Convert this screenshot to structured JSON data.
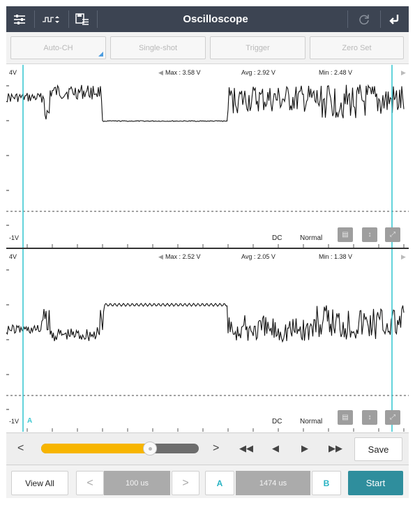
{
  "app": {
    "title": "Oscilloscope"
  },
  "toolbar": {
    "icons": [
      "sliders-icon",
      "waveform-select-icon",
      "save-list-icon",
      "refresh-icon",
      "back-icon"
    ]
  },
  "modes": {
    "auto_ch": "Auto-CH",
    "single_shot": "Single-shot",
    "trigger": "Trigger",
    "zero_set": "Zero Set"
  },
  "channels": [
    {
      "top_label": "4V",
      "bottom_label": "-1V",
      "max": "Max : 3.58 V",
      "avg": "Avg : 2.92 V",
      "min": "Min : 2.48 V",
      "coupling": "DC",
      "mode": "Normal"
    },
    {
      "top_label": "4V",
      "bottom_label": "-1V",
      "max": "Max : 2.52 V",
      "avg": "Avg : 2.05 V",
      "min": "Min : 1.38 V",
      "coupling": "DC",
      "mode": "Normal"
    }
  ],
  "cursors": {
    "a_label": "A",
    "b_label": "B"
  },
  "playback": {
    "prev": "<",
    "next": ">",
    "slider_fraction": 0.69,
    "rewind": "◀◀",
    "step_back": "◀",
    "step_forward": "▶",
    "fast_forward": "▶▶",
    "save": "Save"
  },
  "bottom": {
    "view_all": "View All",
    "dec": "<",
    "timebase": "100 us",
    "inc": ">",
    "cursor_a": "A",
    "cursor_delta": "1474 us",
    "cursor_b": "B",
    "start": "Start"
  },
  "colors": {
    "titlebar": "#3c4452",
    "accent_teal": "#2f8e9d",
    "cursor": "#3cc8d2",
    "slider_fill": "#f7b500"
  }
}
